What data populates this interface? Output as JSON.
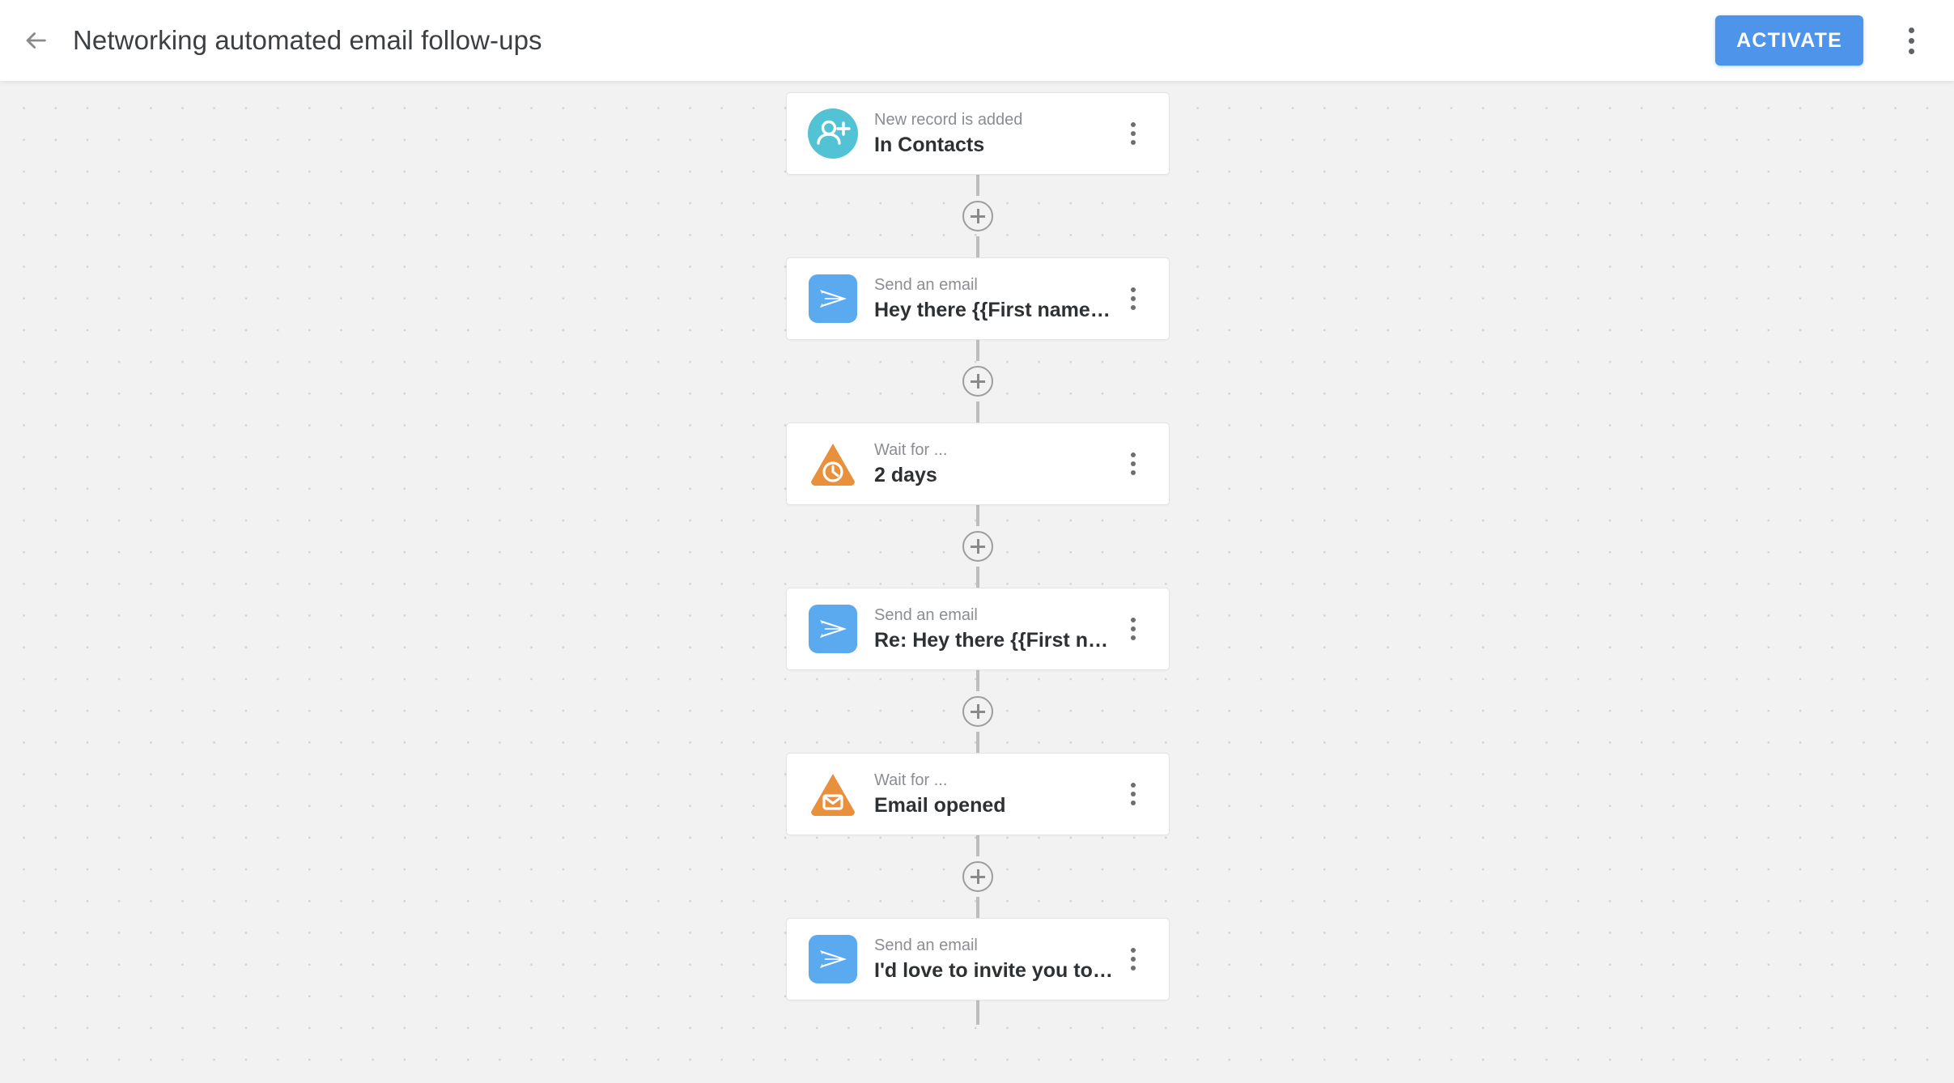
{
  "header": {
    "back_icon": "arrow-left-icon",
    "title": "Networking automated email follow-ups",
    "activate_label": "ACTIVATE",
    "menu_icon": "more-vertical-icon",
    "accent_color": "#4d94ea"
  },
  "canvas": {
    "add_step_label": "+",
    "grid_dot_color": "#d4d4d4",
    "background_color": "#f2f2f2",
    "connector_color": "#bdbdbd"
  },
  "flow": {
    "nodes": [
      {
        "icon": "person-add-icon",
        "icon_shape": "circle",
        "icon_color": "#52c3d4",
        "subtitle": "New record is added",
        "title": "In Contacts",
        "menu_icon": "more-vertical-icon"
      },
      {
        "icon": "send-email-icon",
        "icon_shape": "rounded-square",
        "icon_color": "#5ba9ee",
        "subtitle": "Send an email",
        "title": "Hey there {{First name…",
        "menu_icon": "more-vertical-icon"
      },
      {
        "icon": "clock-icon",
        "icon_shape": "triangle",
        "icon_color": "#e8903c",
        "subtitle": "Wait for ...",
        "title": "2 days",
        "menu_icon": "more-vertical-icon"
      },
      {
        "icon": "send-email-icon",
        "icon_shape": "rounded-square",
        "icon_color": "#5ba9ee",
        "subtitle": "Send an email",
        "title": "Re: Hey there {{First n…",
        "menu_icon": "more-vertical-icon"
      },
      {
        "icon": "envelope-icon",
        "icon_shape": "triangle",
        "icon_color": "#e8903c",
        "subtitle": "Wait for ...",
        "title": "Email opened",
        "menu_icon": "more-vertical-icon"
      },
      {
        "icon": "send-email-icon",
        "icon_shape": "rounded-square",
        "icon_color": "#5ba9ee",
        "subtitle": "Send an email",
        "title": "I'd love to invite you to…",
        "menu_icon": "more-vertical-icon"
      }
    ]
  }
}
